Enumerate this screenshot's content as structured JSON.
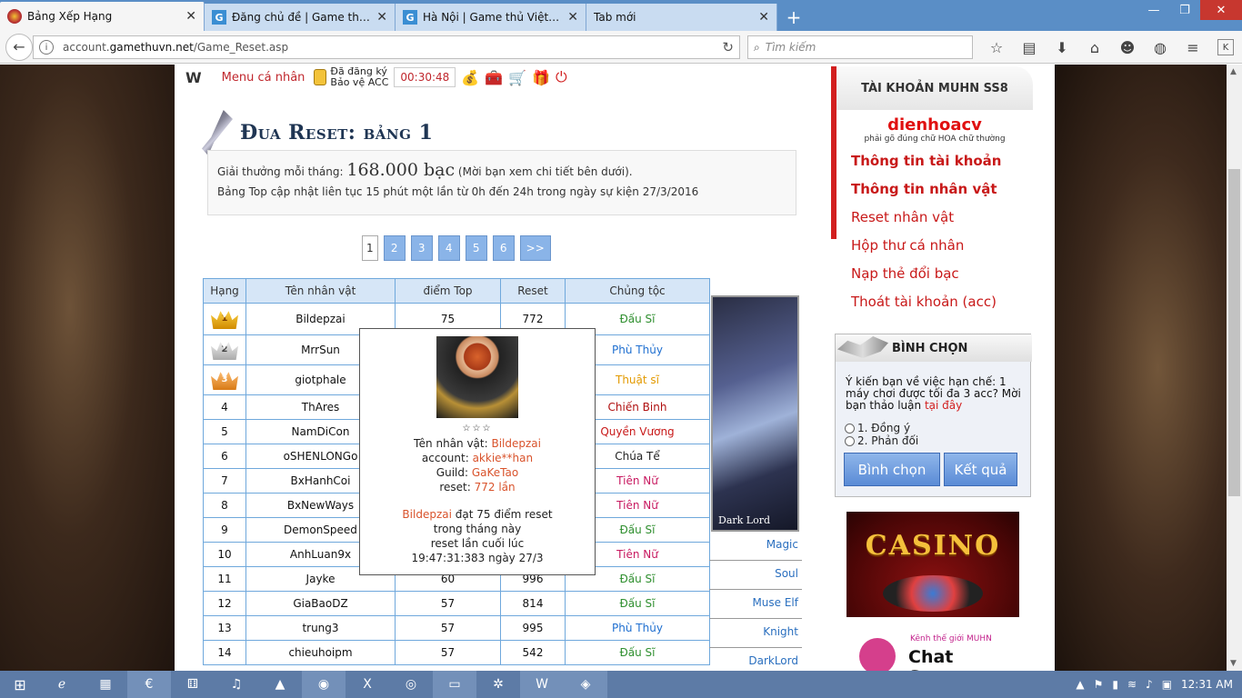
{
  "browser": {
    "tabs": [
      {
        "label": "Bảng Xếp Hạng",
        "active": true
      },
      {
        "label": "Đăng chủ đề | Game thủ V...",
        "active": false
      },
      {
        "label": "Hà Nội | Game thủ Việt Na...",
        "active": false
      },
      {
        "label": "Tab mới",
        "active": false
      }
    ],
    "new_tab": "+",
    "url_prefix": "account.",
    "url_domain": "gamethuvn.net",
    "url_path": "/Game_Reset.asp",
    "search_placeholder": "Tìm kiếm"
  },
  "site_nav": {
    "logo": "W",
    "menu_label": "Menu cá nhân",
    "protect_line1": "Đã đăng ký",
    "protect_line2": "Bảo vệ ACC",
    "timer": "00:30:48"
  },
  "page": {
    "title": "Đua Reset: bảng 1",
    "prize_prefix": "Giải thưởng mỗi tháng: ",
    "prize_amount": "168.000 bạc",
    "prize_suffix": " (Mời bạn xem chi tiết bên dưới).",
    "update_note": "Bảng Top cập nhật liên tục 15 phút một lần từ 0h đến 24h trong ngày sự kiện 27/3/2016",
    "pages": [
      "1",
      "2",
      "3",
      "4",
      "5",
      "6",
      ">>"
    ]
  },
  "table": {
    "headers": [
      "Hạng",
      "Tên nhân vật",
      "điểm Top",
      "Reset",
      "Chủng tộc"
    ],
    "rows": [
      {
        "rank": "1",
        "name": "Bildepzai",
        "points": "75",
        "reset": "772",
        "race": "Đấu Sĩ"
      },
      {
        "rank": "2",
        "name": "MrrSun",
        "points": "",
        "reset": "",
        "race": "Phù Thủy"
      },
      {
        "rank": "3",
        "name": "giotphale",
        "points": "",
        "reset": "",
        "race": "Thuật sĩ"
      },
      {
        "rank": "4",
        "name": "ThAres",
        "points": "",
        "reset": "",
        "race": "Chiến Binh"
      },
      {
        "rank": "5",
        "name": "NamDiCon",
        "points": "",
        "reset": "",
        "race": "Quyền Vương"
      },
      {
        "rank": "6",
        "name": "oSHENLONGo",
        "points": "",
        "reset": "",
        "race": "Chúa Tể"
      },
      {
        "rank": "7",
        "name": "BxHanhCoi",
        "points": "",
        "reset": "",
        "race": "Tiên Nữ"
      },
      {
        "rank": "8",
        "name": "BxNewWays",
        "points": "",
        "reset": "",
        "race": "Tiên Nữ"
      },
      {
        "rank": "9",
        "name": "DemonSpeed",
        "points": "",
        "reset": "",
        "race": "Đấu Sĩ"
      },
      {
        "rank": "10",
        "name": "AnhLuan9x",
        "points": "",
        "reset": "",
        "race": "Tiên Nữ"
      },
      {
        "rank": "11",
        "name": "Jayke",
        "points": "60",
        "reset": "996",
        "race": "Đấu Sĩ"
      },
      {
        "rank": "12",
        "name": "GiaBaoDZ",
        "points": "57",
        "reset": "814",
        "race": "Đấu Sĩ"
      },
      {
        "rank": "13",
        "name": "trung3",
        "points": "57",
        "reset": "995",
        "race": "Phù Thủy"
      },
      {
        "rank": "14",
        "name": "chieuhoipm",
        "points": "57",
        "reset": "542",
        "race": "Đấu Sĩ"
      }
    ],
    "race_colors": {
      "Đấu Sĩ": "#2f8f2f",
      "Phù Thủy": "#1f6fd0",
      "Thuật sĩ": "#e39a00",
      "Chiến Binh": "#b01010",
      "Quyền Vương": "#c81919",
      "Chúa Tể": "#222222",
      "Tiên Nữ": "#c81960"
    }
  },
  "side_char": {
    "caption": "Dark Lord",
    "class_links": [
      "Magic",
      "Soul",
      "Muse Elf",
      "Knight",
      "DarkLord"
    ]
  },
  "popup": {
    "stars": "☆☆☆",
    "name_label": "Tên nhân vật: ",
    "name_value": "Bildepzai",
    "account_label": "account: ",
    "account_value": "akkie**han",
    "guild_label": "Guild: ",
    "guild_value": "GaKeTao",
    "reset_label": "reset: ",
    "reset_value": "772 lần",
    "summary_name": "Bildepzai",
    "summary_rest": " đạt 75 điểm reset",
    "line2": "trong tháng này",
    "line3": "reset lần cuối lúc",
    "line4": "19:47:31:383 ngày 27/3"
  },
  "sidebar": {
    "account_title": "TÀI KHOẢN MUHN SS8",
    "username": "dienhoacv",
    "username_hint": "phải gõ đúng chữ HOA chữ thường",
    "menu": [
      {
        "label": "Thông tin tài khoản",
        "bold": true
      },
      {
        "label": "Thông tin nhân vật",
        "bold": true
      },
      {
        "label": "Reset nhân vật",
        "bold": false
      },
      {
        "label": "Hộp thư cá nhân",
        "bold": false
      },
      {
        "label": "Nạp thẻ đổi bạc",
        "bold": false
      },
      {
        "label": "Thoát tài khoản (acc)",
        "bold": false
      }
    ],
    "poll_title": "BÌNH CHỌN",
    "poll_question": "Ý kiến bạn về việc hạn chế: 1 máy chơi được tối đa 3 acc? Mời bạn thảo luận ",
    "poll_link": "tại đây",
    "poll_options": [
      "1. Đồng ý",
      "2. Phản đối"
    ],
    "vote_button": "Bình chọn",
    "result_button": "Kết quả",
    "casino_text": "CASINO",
    "chat_small": "Kênh thế giới MUHN",
    "chat_big": "Chat Server"
  },
  "taskbar": {
    "time": "12:31 AM"
  }
}
